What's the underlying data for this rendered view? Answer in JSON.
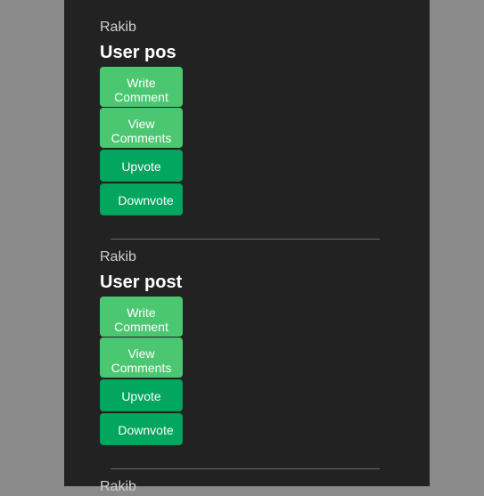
{
  "posts": [
    {
      "author": "Rakib",
      "title": "User pos",
      "write": "Write Comment",
      "view": "View Comments",
      "upvote": "Upvote",
      "downvote": "Downvote"
    },
    {
      "author": "Rakib",
      "title": "User post",
      "write": "Write Comment",
      "view": "View Comments",
      "upvote": "Upvote",
      "downvote": "Downvote"
    },
    {
      "author": "Rakib"
    }
  ]
}
